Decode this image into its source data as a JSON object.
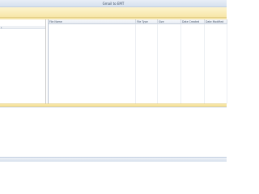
{
  "window": {
    "title": "Gmail to EMT"
  },
  "tree": {
    "expand_glyph": "▸"
  },
  "file_list": {
    "columns": [
      {
        "label": "File Name"
      },
      {
        "label": "File Type"
      },
      {
        "label": "Size"
      },
      {
        "label": "Date Created"
      },
      {
        "label": "Date Modified"
      }
    ],
    "rows": []
  },
  "colors": {
    "toolbar": "#f7e6a8",
    "titlebar": "#d7e1ef",
    "divider": "#f5df93"
  }
}
